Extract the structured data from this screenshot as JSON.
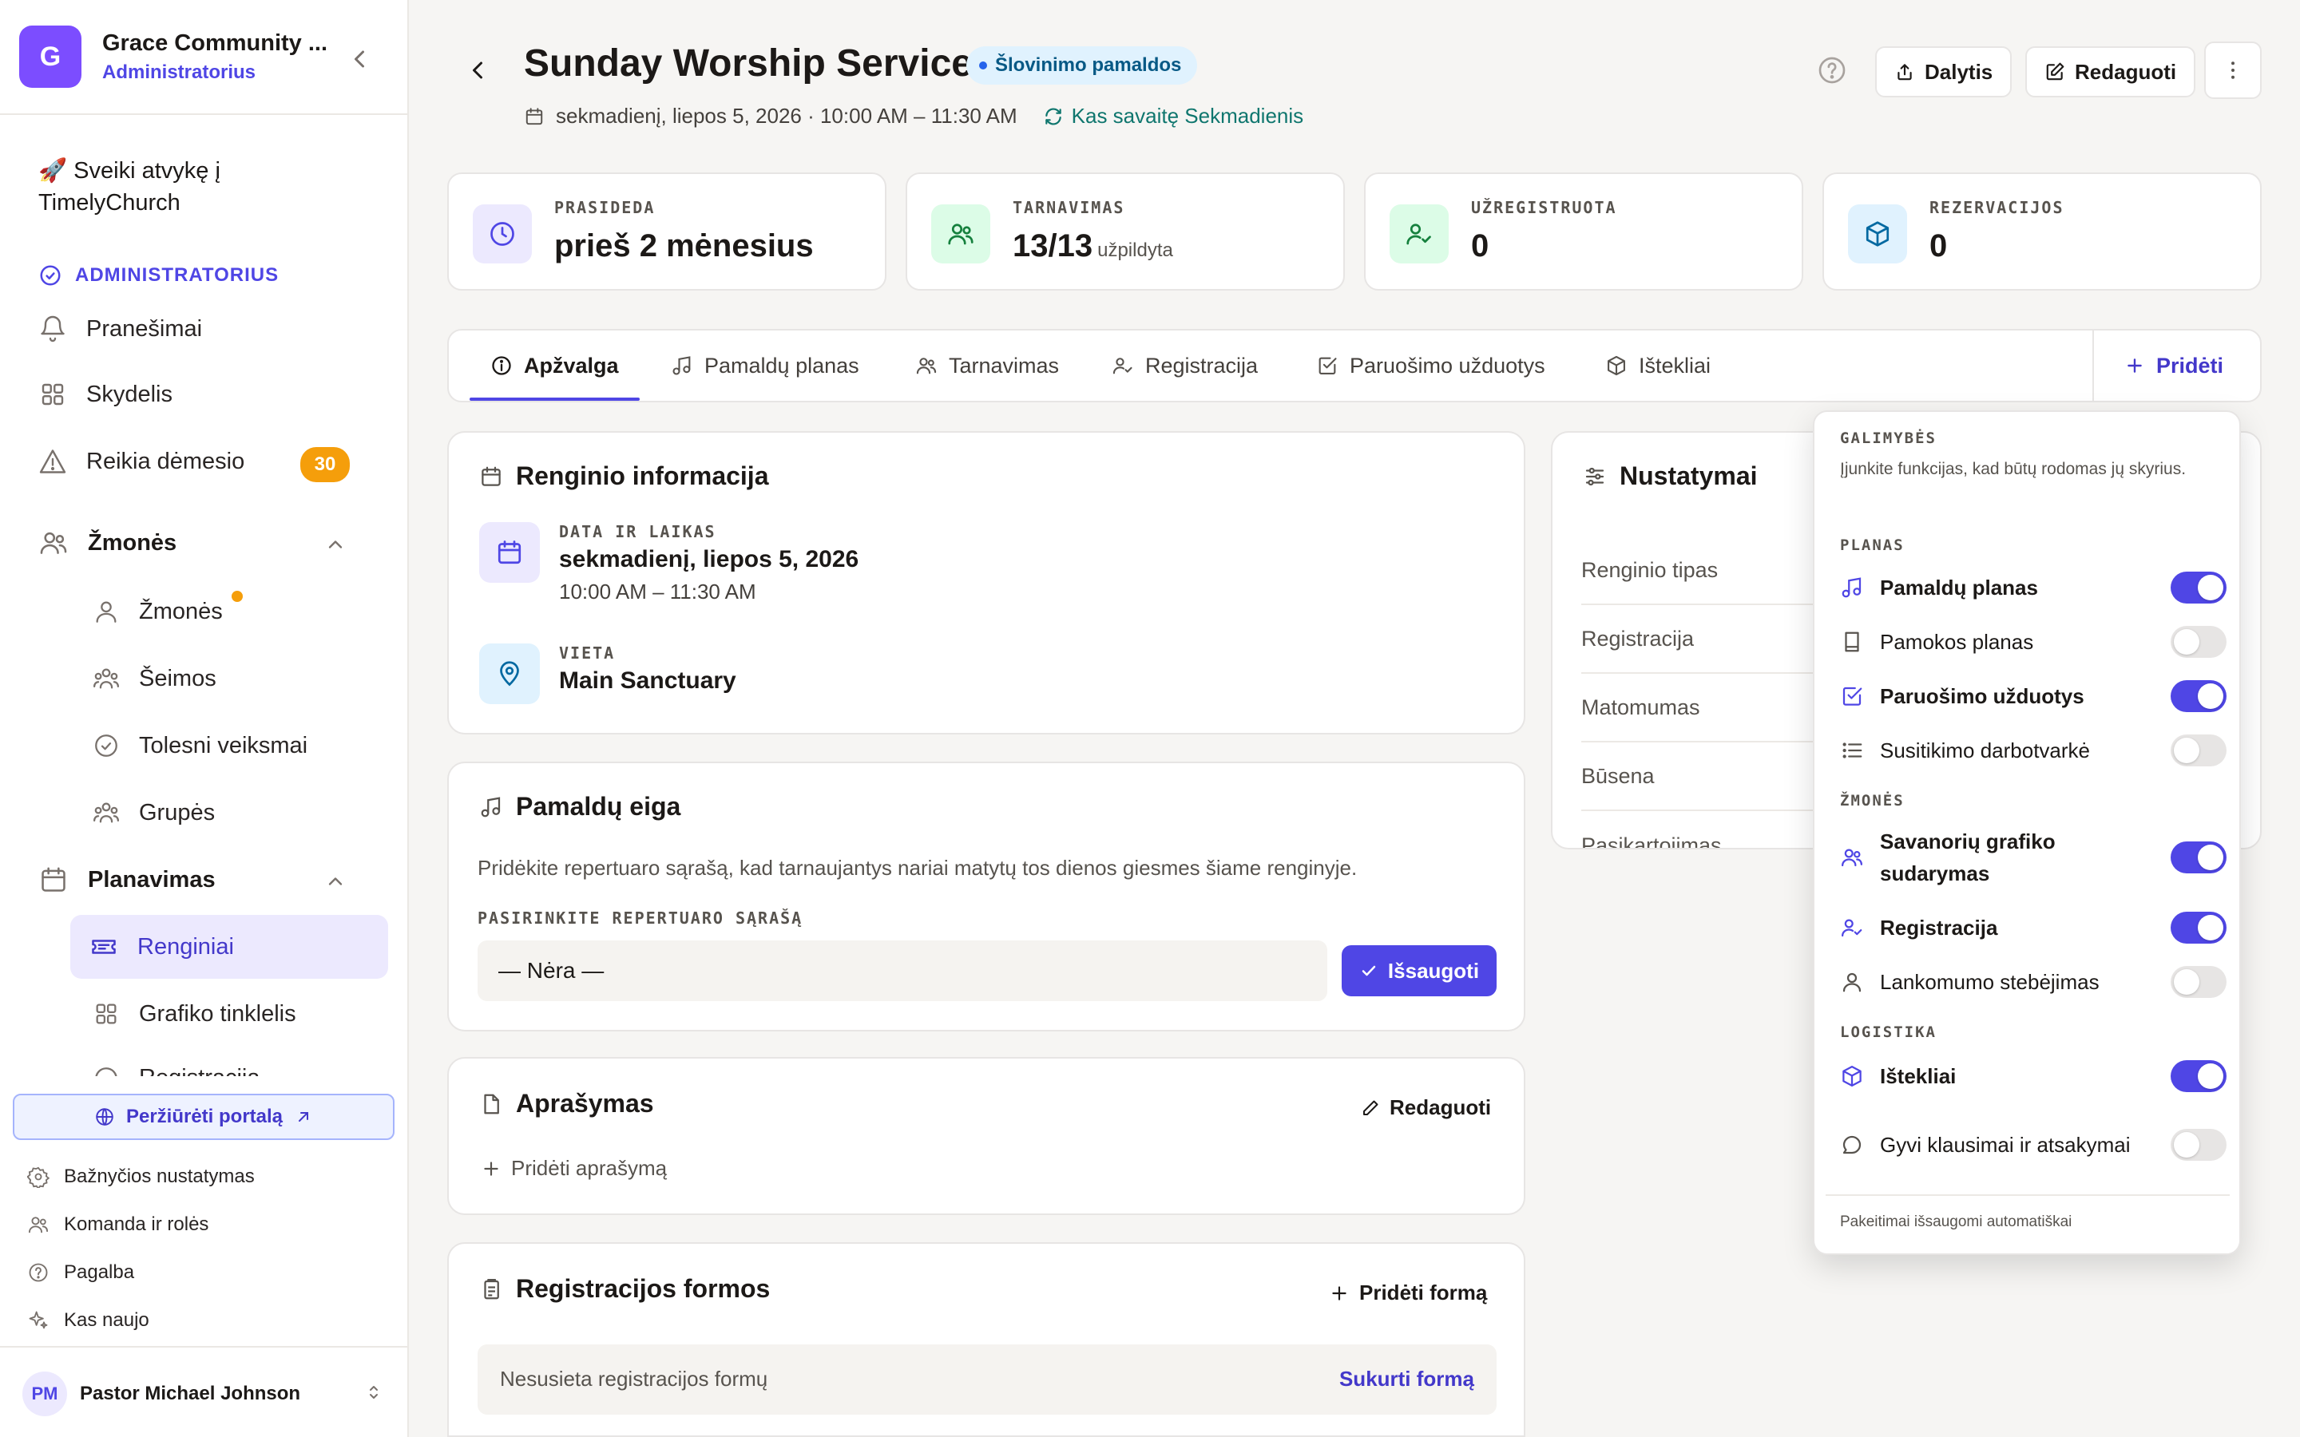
{
  "org": {
    "initial": "G",
    "name": "Grace Community ...",
    "role": "Administratorius"
  },
  "sidebar": {
    "welcome": "🚀 Sveiki atvykę į TimelyChurch",
    "admin_section": "ADMINISTRATORIUS",
    "notifications": "Pranešimai",
    "dashboard": "Skydelis",
    "attention": "Reikia dėmesio",
    "attention_count": "30",
    "people_group": "Žmonės",
    "people": "Žmonės",
    "families": "Šeimos",
    "followups": "Tolesni veiksmai",
    "groups": "Grupės",
    "planning_group": "Planavimas",
    "events": "Renginiai",
    "schedule_grid": "Grafiko tinklelis",
    "registration_partial": "Registracija",
    "portal_button": "Peržiūrėti portalą",
    "church_settings": "Bažnyčios nustatymas",
    "team_roles": "Komanda ir rolės",
    "help": "Pagalba",
    "whats_new": "Kas naujo",
    "user_initials": "PM",
    "user_name": "Pastor Michael Johnson"
  },
  "header": {
    "title": "Sunday Worship Service",
    "type_badge": "Šlovinimo pamaldos",
    "datetime": "sekmadienį, liepos 5, 2026 · 10:00 AM – 11:30 AM",
    "recurrence": "Kas savaitę Sekmadienis",
    "share_button": "Dalytis",
    "edit_button": "Redaguoti"
  },
  "stats": [
    {
      "label": "PRASIDEDA",
      "value": "prieš 2 mėnesius",
      "sub": ""
    },
    {
      "label": "TARNAVIMAS",
      "value": "13/13",
      "sub": "užpildyta"
    },
    {
      "label": "UŽREGISTRUOTA",
      "value": "0",
      "sub": ""
    },
    {
      "label": "REZERVACIJOS",
      "value": "0",
      "sub": ""
    }
  ],
  "tabs": {
    "overview": "Apžvalga",
    "service_plan": "Pamaldų planas",
    "serving": "Tarnavimas",
    "registration": "Registracija",
    "prep_tasks": "Paruošimo užduotys",
    "resources": "Ištekliai",
    "add": "Pridėti"
  },
  "event_info": {
    "title": "Renginio informacija",
    "date_label": "DATA IR LAIKAS",
    "date": "sekmadienį, liepos 5, 2026",
    "time": "10:00 AM – 11:30 AM",
    "location_label": "VIETA",
    "location": "Main Sanctuary"
  },
  "service_flow": {
    "title": "Pamaldų eiga",
    "description": "Pridėkite repertuaro sąrašą, kad tarnaujantys nariai matytų tos dienos giesmes šiame renginyje.",
    "select_label": "PASIRINKITE REPERTUARO SĄRAŠĄ",
    "select_value": "— Nėra —",
    "save_button": "Išsaugoti"
  },
  "description_card": {
    "title": "Aprašymas",
    "edit": "Redaguoti",
    "add": "Pridėti aprašymą"
  },
  "forms_card": {
    "title": "Registracijos formos",
    "add": "Pridėti formą",
    "empty": "Nesusieta registracijos formų",
    "create": "Sukurti formą"
  },
  "settings": {
    "title": "Nustatymai",
    "rows": [
      "Renginio tipas",
      "Registracija",
      "Matomumas",
      "Būsena",
      "Pasikartojimas"
    ]
  },
  "features_popover": {
    "heading": "GALIMYBĖS",
    "description": "Įjunkite funkcijas, kad būtų rodomas jų skyrius.",
    "sections": {
      "plan": "PLANAS",
      "people": "ŽMONĖS",
      "logistics": "LOGISTIKA"
    },
    "items": [
      {
        "label": "Pamaldų planas",
        "enabled": true
      },
      {
        "label": "Pamokos planas",
        "enabled": false
      },
      {
        "label": "Paruošimo užduotys",
        "enabled": true
      },
      {
        "label": "Susitikimo darbotvarkė",
        "enabled": false
      },
      {
        "label": "Savanorių grafiko sudarymas",
        "enabled": true
      },
      {
        "label": "Registracija",
        "enabled": true
      },
      {
        "label": "Lankomumo stebėjimas",
        "enabled": false
      },
      {
        "label": "Ištekliai",
        "enabled": true
      },
      {
        "label": "Gyvi klausimai ir atsakymai",
        "enabled": false
      }
    ],
    "footer": "Pakeitimai išsaugomi automatiškai"
  },
  "colors": {
    "accent": "#4f46e5",
    "brand": "#7c4dff",
    "warning": "#f59e0b"
  }
}
